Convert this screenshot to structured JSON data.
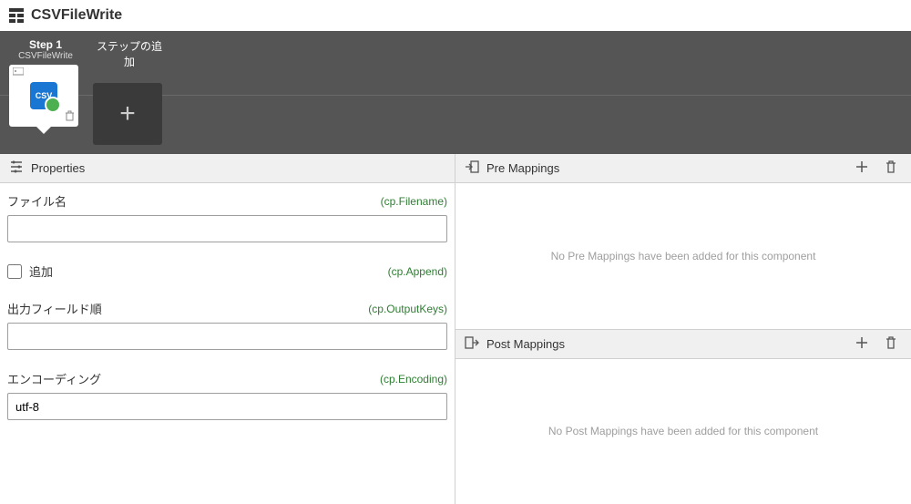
{
  "header": {
    "title": "CSVFileWrite"
  },
  "steps": {
    "step1": {
      "title": "Step 1",
      "subtitle": "CSVFileWrite",
      "icon_text": "CSV"
    },
    "add": {
      "title": "ステップの追加"
    }
  },
  "panels": {
    "properties": {
      "title": "Properties"
    },
    "preMappings": {
      "title": "Pre Mappings",
      "empty": "No Pre Mappings have been added for this component"
    },
    "postMappings": {
      "title": "Post Mappings",
      "empty": "No Post Mappings have been added for this component"
    }
  },
  "fields": {
    "filename": {
      "label": "ファイル名",
      "binding": "(cp.Filename)",
      "value": ""
    },
    "append": {
      "label": "追加",
      "binding": "(cp.Append)",
      "checked": false
    },
    "outputKeys": {
      "label": "出力フィールド順",
      "binding": "(cp.OutputKeys)",
      "value": ""
    },
    "encoding": {
      "label": "エンコーディング",
      "binding": "(cp.Encoding)",
      "value": "utf-8"
    }
  }
}
